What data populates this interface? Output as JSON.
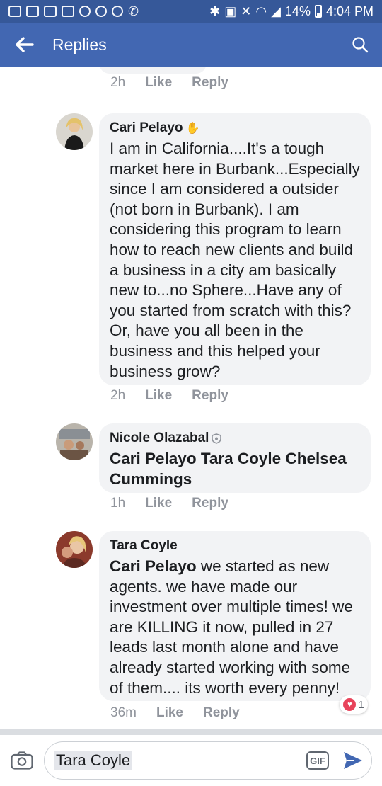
{
  "status_bar": {
    "battery": "14%",
    "time": "4:04 PM",
    "icons": [
      "alert-icon",
      "facebook-icon",
      "calendar-icon",
      "gallery-icon",
      "messenger-icon",
      "vpn-icon",
      "dots-icon",
      "phone-icon",
      "bluetooth-icon",
      "nfc-icon",
      "mute-icon",
      "wifi-icon",
      "signal-icon",
      "battery-icon"
    ]
  },
  "header": {
    "title": "Replies",
    "back_icon": "arrow-left-icon",
    "search_icon": "search-icon",
    "color": "#4267b2"
  },
  "previous_meta": {
    "time": "2h",
    "like": "Like",
    "reply": "Reply"
  },
  "comments": [
    {
      "name": "Cari Pelayo",
      "badge": "wave-icon",
      "text": "I am in California....It's a tough market here in Burbank...Especially since I am considered a outsider (not born in Burbank). I am considering this program to learn how to reach new clients and  build a business in a city am basically new to...no Sphere...Have any of you started from scratch with this? Or, have you all been in the business and this helped your business grow?",
      "time": "2h",
      "like": "Like",
      "reply": "Reply"
    },
    {
      "name": "Nicole Olazabal",
      "badge": "shield-icon",
      "text": "Cari Pelayo Tara Coyle Chelsea Cummings",
      "time": "1h",
      "like": "Like",
      "reply": "Reply"
    },
    {
      "name": "Tara Coyle",
      "mention": "Cari Pelayo",
      "text": " we started as new agents. we have made our investment over multiple times! we are KILLING it now, pulled in 27 leads last month alone and have already started working with some of them.... its worth every penny!",
      "time": "36m",
      "like": "Like",
      "reply": "Reply",
      "reaction": {
        "icon": "heart-icon",
        "count": "1"
      }
    }
  ],
  "composer": {
    "value": "Tara Coyle",
    "camera_icon": "camera-icon",
    "gif_label": "GIF",
    "send_icon": "send-icon"
  }
}
